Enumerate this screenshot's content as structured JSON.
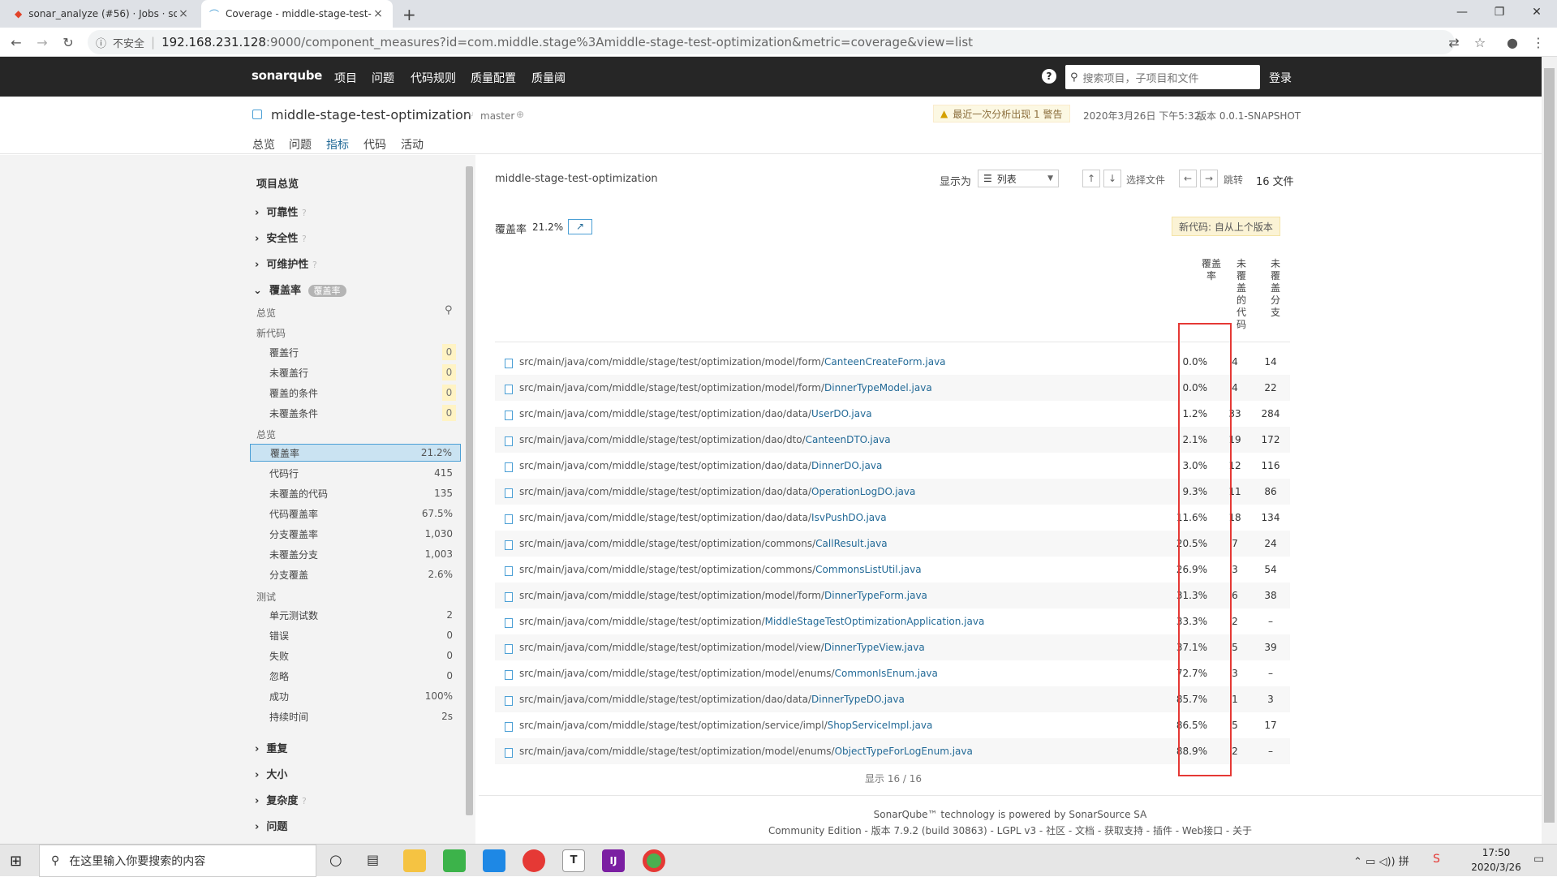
{
  "browser": {
    "tabs": [
      {
        "title": "sonar_analyze (#56) · Jobs · so",
        "close": "×"
      },
      {
        "title": "Coverage - middle-stage-test-",
        "close": "×"
      }
    ],
    "new_tab": "+",
    "window_buttons": [
      "—",
      "❐",
      "✕"
    ],
    "security_label": "不安全",
    "url_host": "192.168.231.128",
    "url_rest": ":9000/component_measures?id=com.middle.stage%3Amiddle-stage-test-optimization&metric=coverage&view=list"
  },
  "sq_nav": {
    "logo": "sonarqube",
    "links": [
      "项目",
      "问题",
      "代码规则",
      "质量配置",
      "质量阈"
    ],
    "help": "?",
    "search_placeholder": "搜索项目，子项目和文件",
    "login": "登录"
  },
  "project": {
    "name": "middle-stage-test-optimization",
    "branch": "master",
    "warning": "最近一次分析出现 1 警告",
    "date": "2020年3月26日 下午5:32",
    "version": "版本 0.0.1-SNAPSHOT",
    "tabs": [
      "总览",
      "问题",
      "指标",
      "代码",
      "活动"
    ]
  },
  "sidebar": {
    "title": "项目总览",
    "domains": [
      "可靠性",
      "安全性",
      "可维护性"
    ],
    "coverage_header": "覆盖率",
    "coverage_badge": "覆盖率",
    "overview_label": "总览",
    "new_code_label": "新代码",
    "new_code_items": [
      {
        "label": "覆盖行",
        "value": "0"
      },
      {
        "label": "未覆盖行",
        "value": "0"
      },
      {
        "label": "覆盖的条件",
        "value": "0"
      },
      {
        "label": "未覆盖条件",
        "value": "0"
      }
    ],
    "overall_label": "总览",
    "overall_items": [
      {
        "label": "覆盖率",
        "value": "21.2%"
      },
      {
        "label": "代码行",
        "value": "415"
      },
      {
        "label": "未覆盖的代码",
        "value": "135"
      },
      {
        "label": "代码覆盖率",
        "value": "67.5%"
      },
      {
        "label": "分支覆盖率",
        "value": "1,030"
      },
      {
        "label": "未覆盖分支",
        "value": "1,003"
      },
      {
        "label": "分支覆盖",
        "value": "2.6%"
      }
    ],
    "tests_label": "测试",
    "test_items": [
      {
        "label": "单元测试数",
        "value": "2"
      },
      {
        "label": "错误",
        "value": "0"
      },
      {
        "label": "失败",
        "value": "0"
      },
      {
        "label": "忽略",
        "value": "0"
      },
      {
        "label": "成功",
        "value": "100%"
      },
      {
        "label": "持续时间",
        "value": "2s"
      }
    ],
    "more_domains": [
      "重复",
      "大小",
      "复杂度",
      "问题"
    ]
  },
  "main": {
    "breadcrumb": "middle-stage-test-optimization",
    "view_label": "显示为",
    "view_value": "列表",
    "select_file": "选择文件",
    "jump": "跳转",
    "file_count": "16 文件",
    "metric_label": "覆盖率",
    "metric_value": "21.2%",
    "new_code_tag": "新代码: 自从上个版本",
    "col1": "覆盖率",
    "col2": "未覆盖的代码",
    "col3": "未覆盖分支",
    "rows": [
      {
        "dir": "src/main/java/com/middle/stage/test/optimization/model/form/",
        "file": "CanteenCreateForm.java",
        "cov": "0.0%",
        "lines": "4",
        "br": "14"
      },
      {
        "dir": "src/main/java/com/middle/stage/test/optimization/model/form/",
        "file": "DinnerTypeModel.java",
        "cov": "0.0%",
        "lines": "4",
        "br": "22"
      },
      {
        "dir": "src/main/java/com/middle/stage/test/optimization/dao/data/",
        "file": "UserDO.java",
        "cov": "1.2%",
        "lines": "33",
        "br": "284"
      },
      {
        "dir": "src/main/java/com/middle/stage/test/optimization/dao/dto/",
        "file": "CanteenDTO.java",
        "cov": "2.1%",
        "lines": "19",
        "br": "172"
      },
      {
        "dir": "src/main/java/com/middle/stage/test/optimization/dao/data/",
        "file": "DinnerDO.java",
        "cov": "3.0%",
        "lines": "12",
        "br": "116"
      },
      {
        "dir": "src/main/java/com/middle/stage/test/optimization/dao/data/",
        "file": "OperationLogDO.java",
        "cov": "9.3%",
        "lines": "11",
        "br": "86"
      },
      {
        "dir": "src/main/java/com/middle/stage/test/optimization/dao/data/",
        "file": "IsvPushDO.java",
        "cov": "11.6%",
        "lines": "18",
        "br": "134"
      },
      {
        "dir": "src/main/java/com/middle/stage/test/optimization/commons/",
        "file": "CallResult.java",
        "cov": "20.5%",
        "lines": "7",
        "br": "24"
      },
      {
        "dir": "src/main/java/com/middle/stage/test/optimization/commons/",
        "file": "CommonsListUtil.java",
        "cov": "26.9%",
        "lines": "3",
        "br": "54"
      },
      {
        "dir": "src/main/java/com/middle/stage/test/optimization/model/form/",
        "file": "DinnerTypeForm.java",
        "cov": "31.3%",
        "lines": "6",
        "br": "38"
      },
      {
        "dir": "src/main/java/com/middle/stage/test/optimization/",
        "file": "MiddleStageTestOptimizationApplication.java",
        "cov": "33.3%",
        "lines": "2",
        "br": "–"
      },
      {
        "dir": "src/main/java/com/middle/stage/test/optimization/model/view/",
        "file": "DinnerTypeView.java",
        "cov": "37.1%",
        "lines": "5",
        "br": "39"
      },
      {
        "dir": "src/main/java/com/middle/stage/test/optimization/model/enums/",
        "file": "CommonIsEnum.java",
        "cov": "72.7%",
        "lines": "3",
        "br": "–"
      },
      {
        "dir": "src/main/java/com/middle/stage/test/optimization/dao/data/",
        "file": "DinnerTypeDO.java",
        "cov": "85.7%",
        "lines": "1",
        "br": "3"
      },
      {
        "dir": "src/main/java/com/middle/stage/test/optimization/service/impl/",
        "file": "ShopServiceImpl.java",
        "cov": "86.5%",
        "lines": "5",
        "br": "17"
      },
      {
        "dir": "src/main/java/com/middle/stage/test/optimization/model/enums/",
        "file": "ObjectTypeForLogEnum.java",
        "cov": "88.9%",
        "lines": "2",
        "br": "–"
      }
    ],
    "shown": "显示 16 / 16"
  },
  "footer": {
    "line1": "SonarQube™ technology is powered by SonarSource SA",
    "line2": "Community Edition - 版本 7.9.2 (build 30863) - LGPL v3 - 社区 - 文档 - 获取支持 - 插件 - Web接口 - 关于"
  },
  "taskbar": {
    "search_placeholder": "在这里输入你要搜索的内容",
    "time": "17:50",
    "date": "2020/3/26"
  },
  "colors": {
    "sq_dark": "#262626",
    "link": "#236a97",
    "highlight_box": "#e53935"
  }
}
